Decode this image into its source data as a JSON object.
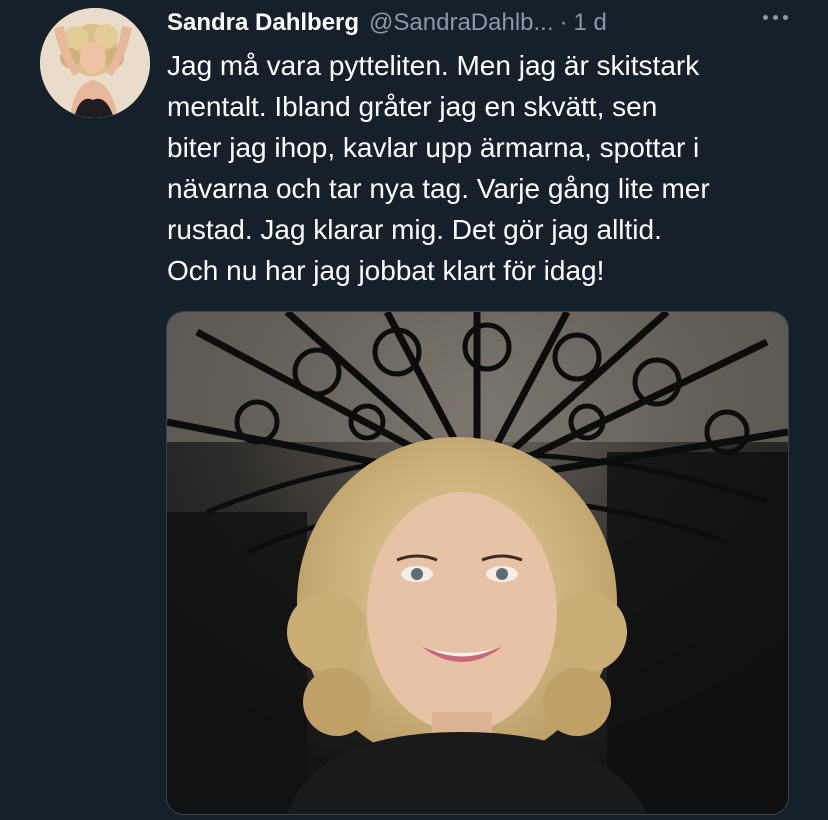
{
  "tweet": {
    "author_name": "Sandra Dahlberg",
    "handle": "@SandraDahlb...",
    "separator": "·",
    "timestamp": "1 d",
    "text_lines": [
      "Jag må vara pytteliten. Men jag är skitstark",
      "mentalt. Ibland gråter jag en skvätt, sen",
      "biter jag ihop, kavlar upp ärmarna, spottar i",
      "nävarna och tar nya tag. Varje gång lite mer",
      "rustad. Jag klarar mig. Det gör jag alltid.",
      "Och nu har jag jobbat klart för idag!"
    ],
    "more_icon": "more-horizontal-icon"
  },
  "colors": {
    "background": "#15202b",
    "text_primary": "#ffffff",
    "text_secondary": "#8b98a5",
    "border": "#38444d"
  }
}
